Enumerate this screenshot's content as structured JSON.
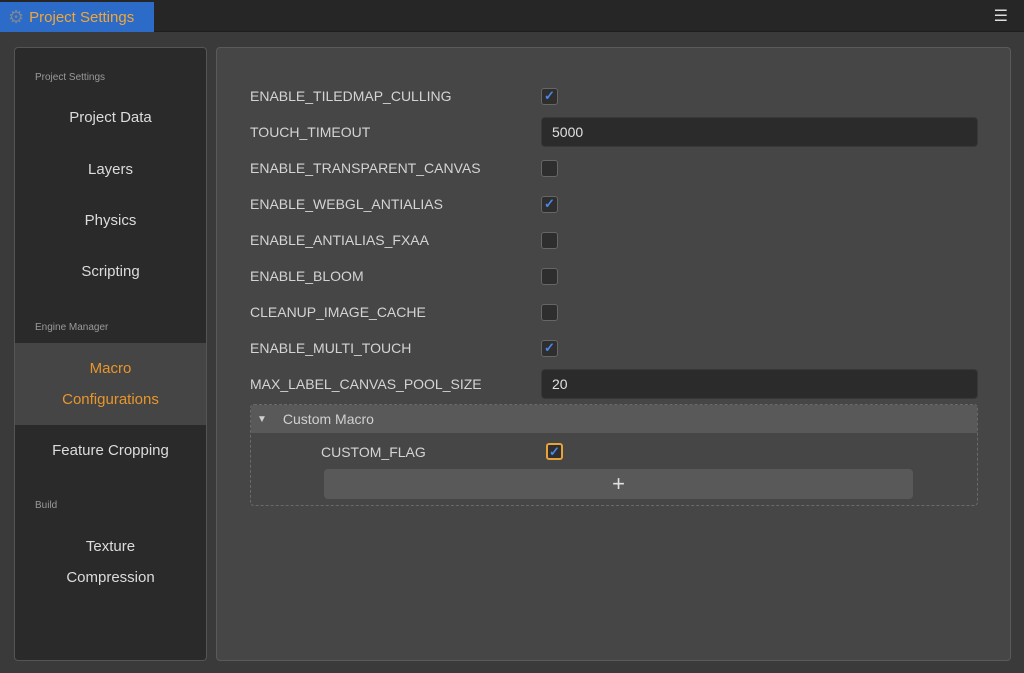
{
  "tab": {
    "title": "Project Settings",
    "icon": "gear-icon"
  },
  "sidebar": {
    "sections": [
      "Project Settings",
      "Engine Manager",
      "Build"
    ],
    "items": [
      "Project Data",
      "Layers",
      "Physics",
      "Scripting",
      "Macro Configurations",
      "Feature Cropping",
      "Texture Compression"
    ],
    "active": "Macro Configurations"
  },
  "accent": "#e8962c",
  "macros": [
    {
      "label": "ENABLE_TILEDMAP_CULLING",
      "type": "checkbox",
      "checked": true
    },
    {
      "label": "TOUCH_TIMEOUT",
      "type": "input",
      "value": "5000"
    },
    {
      "label": "ENABLE_TRANSPARENT_CANVAS",
      "type": "checkbox",
      "checked": false
    },
    {
      "label": "ENABLE_WEBGL_ANTIALIAS",
      "type": "checkbox",
      "checked": true
    },
    {
      "label": "ENABLE_ANTIALIAS_FXAA",
      "type": "checkbox",
      "checked": false
    },
    {
      "label": "ENABLE_BLOOM",
      "type": "checkbox",
      "checked": false
    },
    {
      "label": "CLEANUP_IMAGE_CACHE",
      "type": "checkbox",
      "checked": false
    },
    {
      "label": "ENABLE_MULTI_TOUCH",
      "type": "checkbox",
      "checked": true
    },
    {
      "label": "MAX_LABEL_CANVAS_POOL_SIZE",
      "type": "input",
      "value": "20"
    }
  ],
  "custom": {
    "title": "Custom Macro",
    "items": [
      {
        "label": "CUSTOM_FLAG",
        "checked": true
      }
    ],
    "add_label": "+"
  }
}
